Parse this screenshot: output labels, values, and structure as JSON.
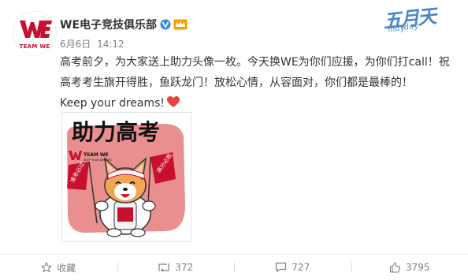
{
  "user": {
    "name": "WE电子竞技俱乐部",
    "avatar_label": "TEAM WE"
  },
  "meta": {
    "date": "6月6日",
    "time": "14:12"
  },
  "post": {
    "line1": "高考前夕，为大家送上助力头像一枚。今天换WE为你们应援，为你们打call！祝",
    "line2": "高考考生旗开得胜，鱼跃龙门！放松心情，从容面对，你们都是最棒的！",
    "line3": "Keep your dreams!"
  },
  "image": {
    "title_chars": "助力高考",
    "logo_text": "TEAM WE",
    "logo_sub": "KEEP YOUR DREAMS",
    "flag_left": "逢考必过",
    "flag_right": "高分必胜"
  },
  "stamp": {
    "big": "五月天",
    "small": "mayday"
  },
  "actions": {
    "favorite_label": "收藏",
    "repost_count": "372",
    "comment_count": "727",
    "like_count": "3795"
  },
  "colors": {
    "brand_red": "#c8102e",
    "text": "#333333",
    "meta": "#808080",
    "verified_blue": "#2d8cf0",
    "vip_orange": "#f7a000",
    "heart": "#e8453c"
  }
}
